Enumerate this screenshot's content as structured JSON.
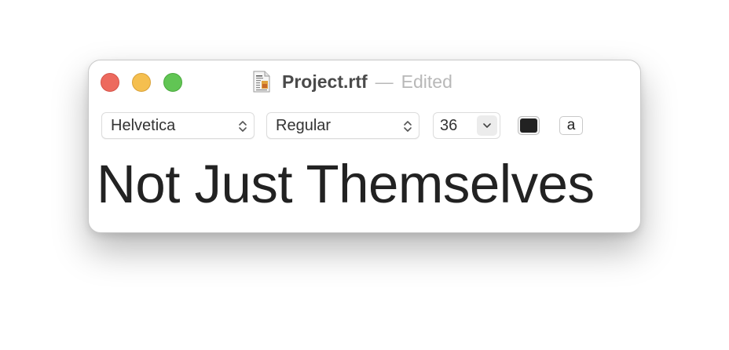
{
  "window": {
    "filename": "Project.rtf",
    "separator": "—",
    "status": "Edited"
  },
  "toolbar": {
    "font_family": "Helvetica",
    "font_style": "Regular",
    "font_size": "36",
    "text_color": "#222222",
    "background_color_button_label": "a"
  },
  "document": {
    "text": "Not Just Themselves"
  },
  "colors": {
    "close": "#ed6a5e",
    "minimize": "#f5bf4f",
    "zoom": "#61c554"
  }
}
